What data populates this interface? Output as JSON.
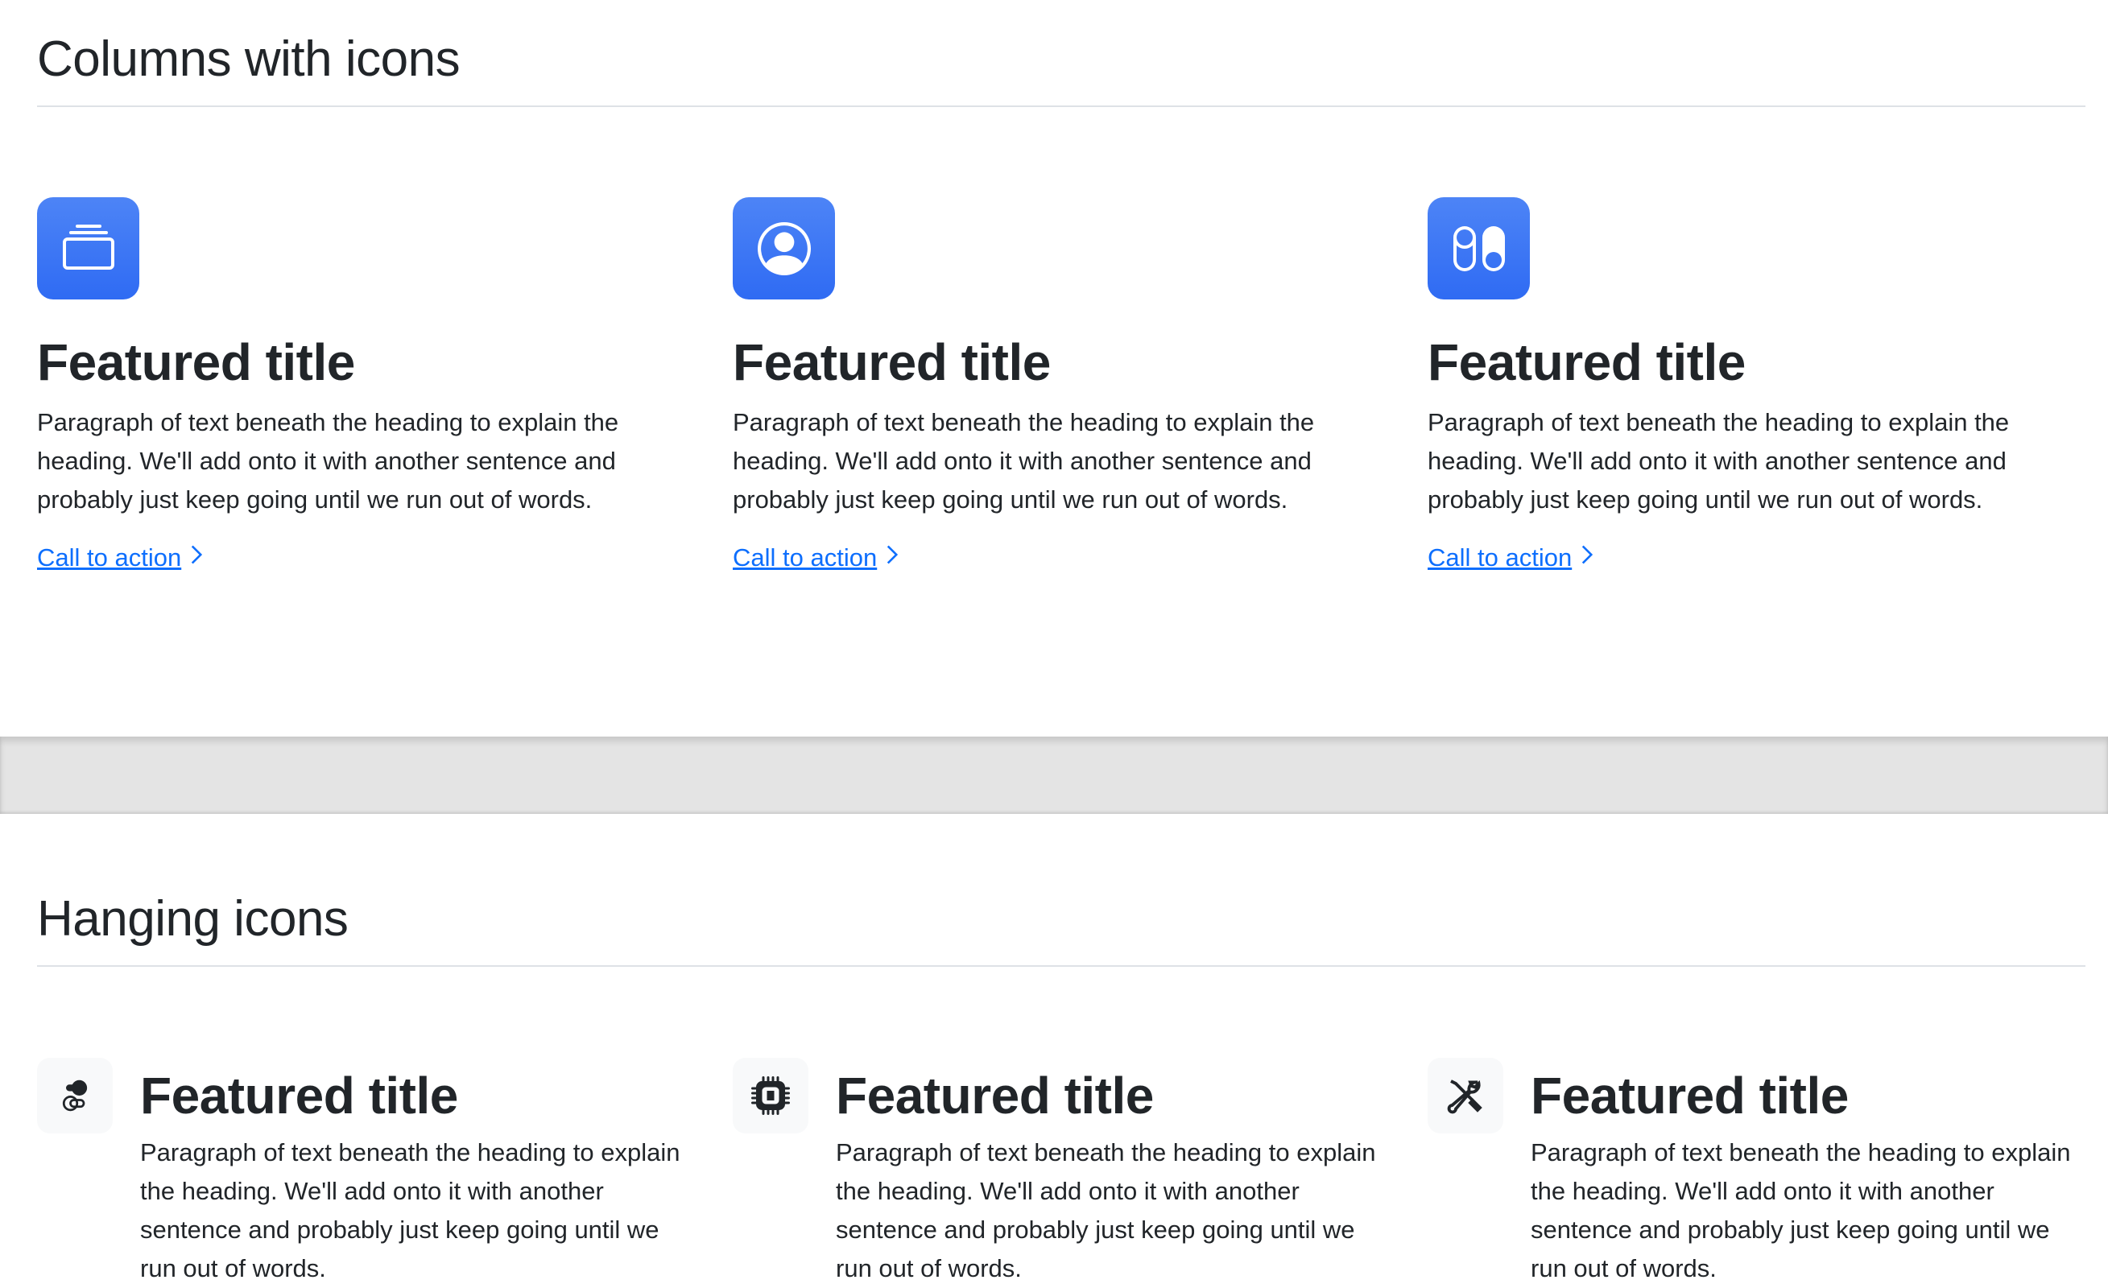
{
  "section1": {
    "heading": "Columns with icons",
    "columns": [
      {
        "icon": "collection-icon",
        "title": "Featured title",
        "text": "Paragraph of text beneath the heading to explain the heading. We'll add onto it with another sentence and probably just keep going until we run out of words.",
        "cta": "Call to action"
      },
      {
        "icon": "person-circle-icon",
        "title": "Featured title",
        "text": "Paragraph of text beneath the heading to explain the heading. We'll add onto it with another sentence and probably just keep going until we run out of words.",
        "cta": "Call to action"
      },
      {
        "icon": "toggles-icon",
        "title": "Featured title",
        "text": "Paragraph of text beneath the heading to explain the heading. We'll add onto it with another sentence and probably just keep going until we run out of words.",
        "cta": "Call to action"
      }
    ]
  },
  "section2": {
    "heading": "Hanging icons",
    "columns": [
      {
        "icon": "toggles-icon",
        "title": "Featured title",
        "text": "Paragraph of text beneath the heading to explain the heading. We'll add onto it with another sentence and probably just keep going until we run out of words."
      },
      {
        "icon": "cpu-icon",
        "title": "Featured title",
        "text": "Paragraph of text beneath the heading to explain the heading. We'll add onto it with another sentence and probably just keep going until we run out of words."
      },
      {
        "icon": "tools-icon",
        "title": "Featured title",
        "text": "Paragraph of text beneath the heading to explain the heading. We'll add onto it with another sentence and probably just keep going until we run out of words."
      }
    ]
  },
  "colors": {
    "accent": "#0d6efd",
    "icon_bg": "#3a75f4"
  }
}
